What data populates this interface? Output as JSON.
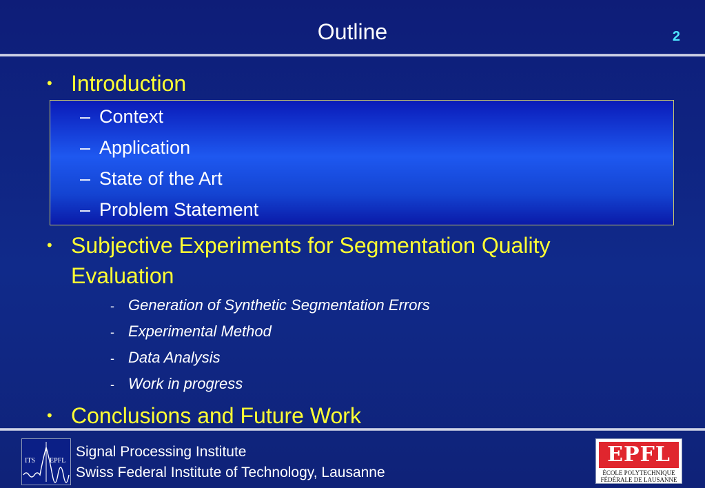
{
  "header": {
    "title": "Outline",
    "page_number": "2"
  },
  "outline": {
    "sections": [
      {
        "label": "Introduction"
      },
      {
        "label": "Subjective Experiments for Segmentation Quality Evaluation"
      },
      {
        "label": "Conclusions and Future Work"
      }
    ],
    "introduction_items": [
      "Context",
      "Application",
      "State of the Art",
      "Problem Statement"
    ],
    "experiment_items": [
      "Generation of Synthetic Segmentation Errors",
      "Experimental Method",
      "Data Analysis",
      "Work in progress"
    ],
    "bullet_symbol": "•",
    "dash_symbol": "–",
    "small_dash_symbol": "-"
  },
  "footer": {
    "line1": "Signal Processing Institute",
    "line2": "Swiss Federal Institute of Technology, Lausanne",
    "its_logo": {
      "left": "ITS",
      "right": "EPFL"
    },
    "epfl_logo": {
      "word": "EPFL",
      "line1": "ÉCOLE  POLYTECHNIQUE",
      "line2": "FÉDÉRALE DE LAUSANNE"
    }
  },
  "colors": {
    "background": "#102a8a",
    "highlight_box": "#1e58f0",
    "heading_text": "#ffff33",
    "page_number": "#4fe6ff"
  }
}
